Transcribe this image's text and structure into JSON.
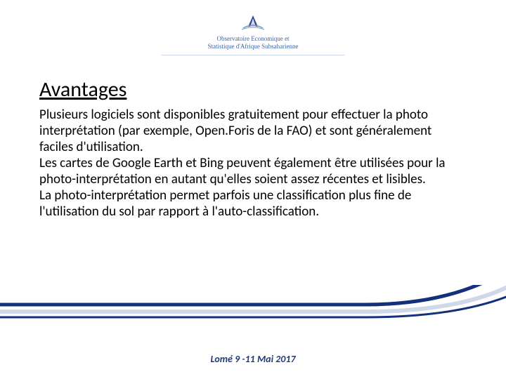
{
  "header": {
    "org_line1": "Observatoire Economique et",
    "org_line2": "Statistique d'Afrique Subsaharienne"
  },
  "slide": {
    "title": "Avantages",
    "paragraph1": "Plusieurs logiciels sont disponibles gratuitement pour effectuer la photo interprétation (par exemple, Open.Foris de la FAO) et sont généralement faciles d'utilisation.",
    "paragraph2": "Les cartes de Google Earth et Bing peuvent également être utilisées pour la photo-interprétation en autant qu'elles soient assez récentes et lisibles.",
    "paragraph3": "La photo-interprétation permet parfois une classification plus fine de l'utilisation du sol par rapport à l'auto-classification."
  },
  "footer": {
    "text": "Lomé 9 -11 Mai 2017"
  },
  "colors": {
    "accent": "#1f3b73",
    "curve": "#14307a"
  }
}
